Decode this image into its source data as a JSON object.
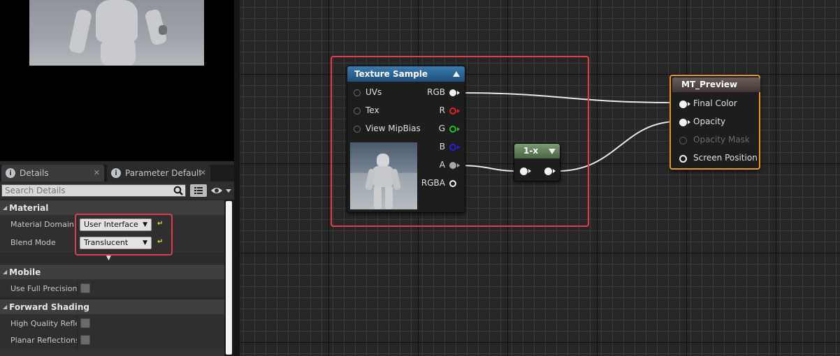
{
  "viewport": {
    "name": "material-preview-viewport"
  },
  "tabs": [
    {
      "label": "Details",
      "icon": "info-icon"
    },
    {
      "label": "Parameter Defaults",
      "icon": "info-icon"
    }
  ],
  "search": {
    "placeholder": "Search Details"
  },
  "details": {
    "material": {
      "header": "Material",
      "material_domain": {
        "label": "Material Domain",
        "value": "User Interface"
      },
      "blend_mode": {
        "label": "Blend Mode",
        "value": "Translucent"
      }
    },
    "mobile": {
      "header": "Mobile",
      "use_full_precision": {
        "label": "Use Full Precision",
        "checked": false
      }
    },
    "forward_shading": {
      "header": "Forward Shading",
      "high_quality_reflections": {
        "label": "High Quality Reflec",
        "checked": false
      },
      "planar_reflections": {
        "label": "Planar Reflections",
        "checked": false
      }
    }
  },
  "graph": {
    "texture_sample": {
      "title": "Texture Sample",
      "inputs": [
        "UVs",
        "Tex",
        "View MipBias"
      ],
      "outputs": [
        "RGB",
        "R",
        "G",
        "B",
        "A",
        "RGBA"
      ]
    },
    "one_minus": {
      "title": "1-x"
    },
    "result": {
      "title": "MT_Preview",
      "inputs": [
        "Final Color",
        "Opacity",
        "Opacity Mask",
        "Screen Position"
      ]
    }
  },
  "colors": {
    "highlight": "#e03c4c",
    "result_border": "#e69a1c",
    "texture_title": "#2a5f8a",
    "one_minus_title": "#5f7a5a",
    "pin_r": "#e02020",
    "pin_g": "#20c020",
    "pin_b": "#2020e0"
  }
}
